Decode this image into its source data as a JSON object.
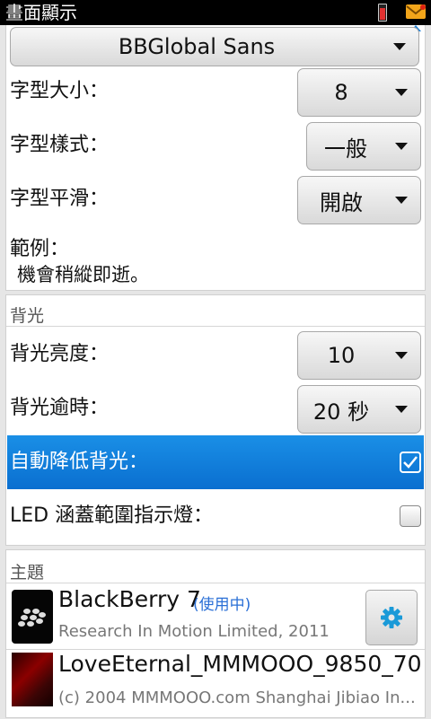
{
  "status_bar": {
    "title": "畫面顯示"
  },
  "font_section": {
    "font_family_value": "BBGlobal Sans",
    "font_size_label": "字型大小：",
    "font_size_value": "8",
    "font_style_label": "字型樣式：",
    "font_style_value": "一般",
    "font_smoothing_label": "字型平滑：",
    "font_smoothing_value": "開啟",
    "sample_label": "範例：",
    "sample_text": "機會稍縱即逝。"
  },
  "backlight_section": {
    "header": "背光",
    "brightness_label": "背光亮度：",
    "brightness_value": "10",
    "timeout_label": "背光逾時：",
    "timeout_value": "20 秒",
    "auto_dim_label": "自動降低背光：",
    "auto_dim_checked": true,
    "led_label": "LED 涵蓋範圍指示燈：",
    "led_checked": false
  },
  "theme_section": {
    "header": "主題",
    "themes": [
      {
        "name": "BlackBerry 7",
        "status": "(使用中)",
        "subtitle": "Research In Motion Limited, 2011"
      },
      {
        "name": "LoveEternal_MMMOOO_9850_70",
        "subtitle": "(c) 2004 MMMOOO.com Shanghai Jibiao In..."
      }
    ]
  },
  "colors": {
    "highlight": "#0a7ad8",
    "accent_link": "#2a6fd6",
    "gear": "#1a9ad8",
    "mail_icon": "#f2a51a",
    "battery_level": "#e03030"
  },
  "icons": [
    "battery-icon",
    "mail-icon",
    "dropdown-arrow-icon",
    "check-icon",
    "gear-icon",
    "blackberry-logo-icon"
  ]
}
